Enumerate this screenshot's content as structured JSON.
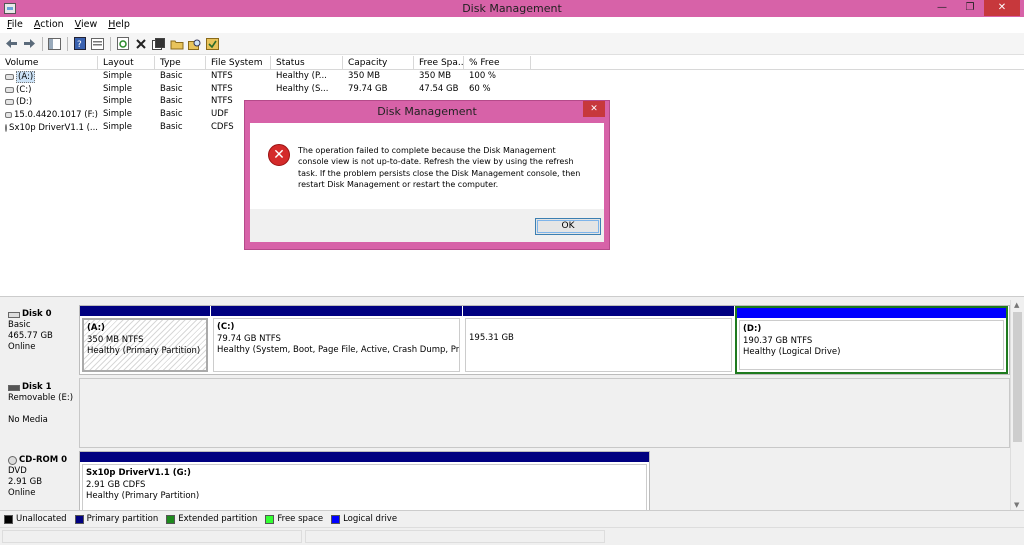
{
  "window": {
    "title": "Disk Management",
    "controls": [
      "—",
      "❐",
      "✕"
    ]
  },
  "menu": [
    {
      "key": "F",
      "rest": "ile"
    },
    {
      "key": "A",
      "rest": "ction"
    },
    {
      "key": "V",
      "rest": "iew"
    },
    {
      "key": "H",
      "rest": "elp"
    }
  ],
  "toolbar": {
    "icons": [
      "back-arrow-icon",
      "forward-arrow-icon",
      "console-tree-icon",
      "help-icon",
      "properties-icon",
      "refresh-icon",
      "delete-icon",
      "properties-sheet-icon",
      "open-folder-icon",
      "explore-icon",
      "show-hide-icon"
    ]
  },
  "volumes": {
    "headers": [
      "Volume",
      "Layout",
      "Type",
      "File System",
      "Status",
      "Capacity",
      "Free Spa...",
      "% Free"
    ],
    "rows": [
      {
        "volume": "(A:)",
        "layout": "Simple",
        "type": "Basic",
        "fs": "NTFS",
        "status": "Healthy (P...",
        "capacity": "350 MB",
        "free": "350 MB",
        "pct": "100 %",
        "icon": "drive"
      },
      {
        "volume": "(C:)",
        "layout": "Simple",
        "type": "Basic",
        "fs": "NTFS",
        "status": "Healthy (S...",
        "capacity": "79.74 GB",
        "free": "47.54 GB",
        "pct": "60 %",
        "icon": "drive"
      },
      {
        "volume": "(D:)",
        "layout": "Simple",
        "type": "Basic",
        "fs": "NTFS",
        "status": "",
        "capacity": "",
        "free": "",
        "pct": "",
        "icon": "drive"
      },
      {
        "volume": "15.0.4420.1017 (F:)",
        "layout": "Simple",
        "type": "Basic",
        "fs": "UDF",
        "status": "",
        "capacity": "",
        "free": "",
        "pct": "",
        "icon": "drive"
      },
      {
        "volume": "Sx10p DriverV1.1 (...",
        "layout": "Simple",
        "type": "Basic",
        "fs": "CDFS",
        "status": "",
        "capacity": "",
        "free": "",
        "pct": "",
        "icon": "cd"
      }
    ]
  },
  "disks": {
    "disk0": {
      "name": "Disk 0",
      "type": "Basic",
      "size": "465.77 GB",
      "state": "Online",
      "partitions": [
        {
          "label": "(A:)",
          "size": "350 MB NTFS",
          "status": "Healthy (Primary Partition)"
        },
        {
          "label": "(C:)",
          "size": "79.74 GB NTFS",
          "status": "Healthy (System, Boot, Page File, Active, Crash Dump, Primar"
        },
        {
          "label": "",
          "size": "195.31 GB",
          "status": ""
        },
        {
          "label": "(D:)",
          "size": "190.37 GB NTFS",
          "status": "Healthy (Logical Drive)"
        }
      ]
    },
    "disk1": {
      "name": "Disk 1",
      "type": "Removable (E:)",
      "state": "No Media"
    },
    "cdrom0": {
      "name": "CD-ROM 0",
      "type": "DVD",
      "size": "2.91 GB",
      "state": "Online",
      "partitions": [
        {
          "label": "Sx10p DriverV1.1  (G:)",
          "size": "2.91 GB CDFS",
          "status": "Healthy (Primary Partition)"
        }
      ]
    }
  },
  "legend": [
    {
      "label": "Unallocated",
      "color": "#000000"
    },
    {
      "label": "Primary partition",
      "color": "#000080"
    },
    {
      "label": "Extended partition",
      "color": "#1e8a1e"
    },
    {
      "label": "Free space",
      "color": "#33ff33"
    },
    {
      "label": "Logical drive",
      "color": "#0000ff"
    }
  ],
  "dialog": {
    "title": "Disk Management",
    "close": "✕",
    "icon": "error-icon",
    "lines": [
      "The operation failed to complete because the Disk Management",
      "console view is not up-to-date.  Refresh the view by using the refresh",
      "task. If the problem persists close the Disk Management console, then",
      "restart Disk Management or restart the computer."
    ],
    "ok": "OK"
  },
  "colors": {
    "accent": "#d762a8",
    "primary_partition": "#000080",
    "logical_drive": "#0000ff",
    "selection_border": "#1e7a1e"
  }
}
